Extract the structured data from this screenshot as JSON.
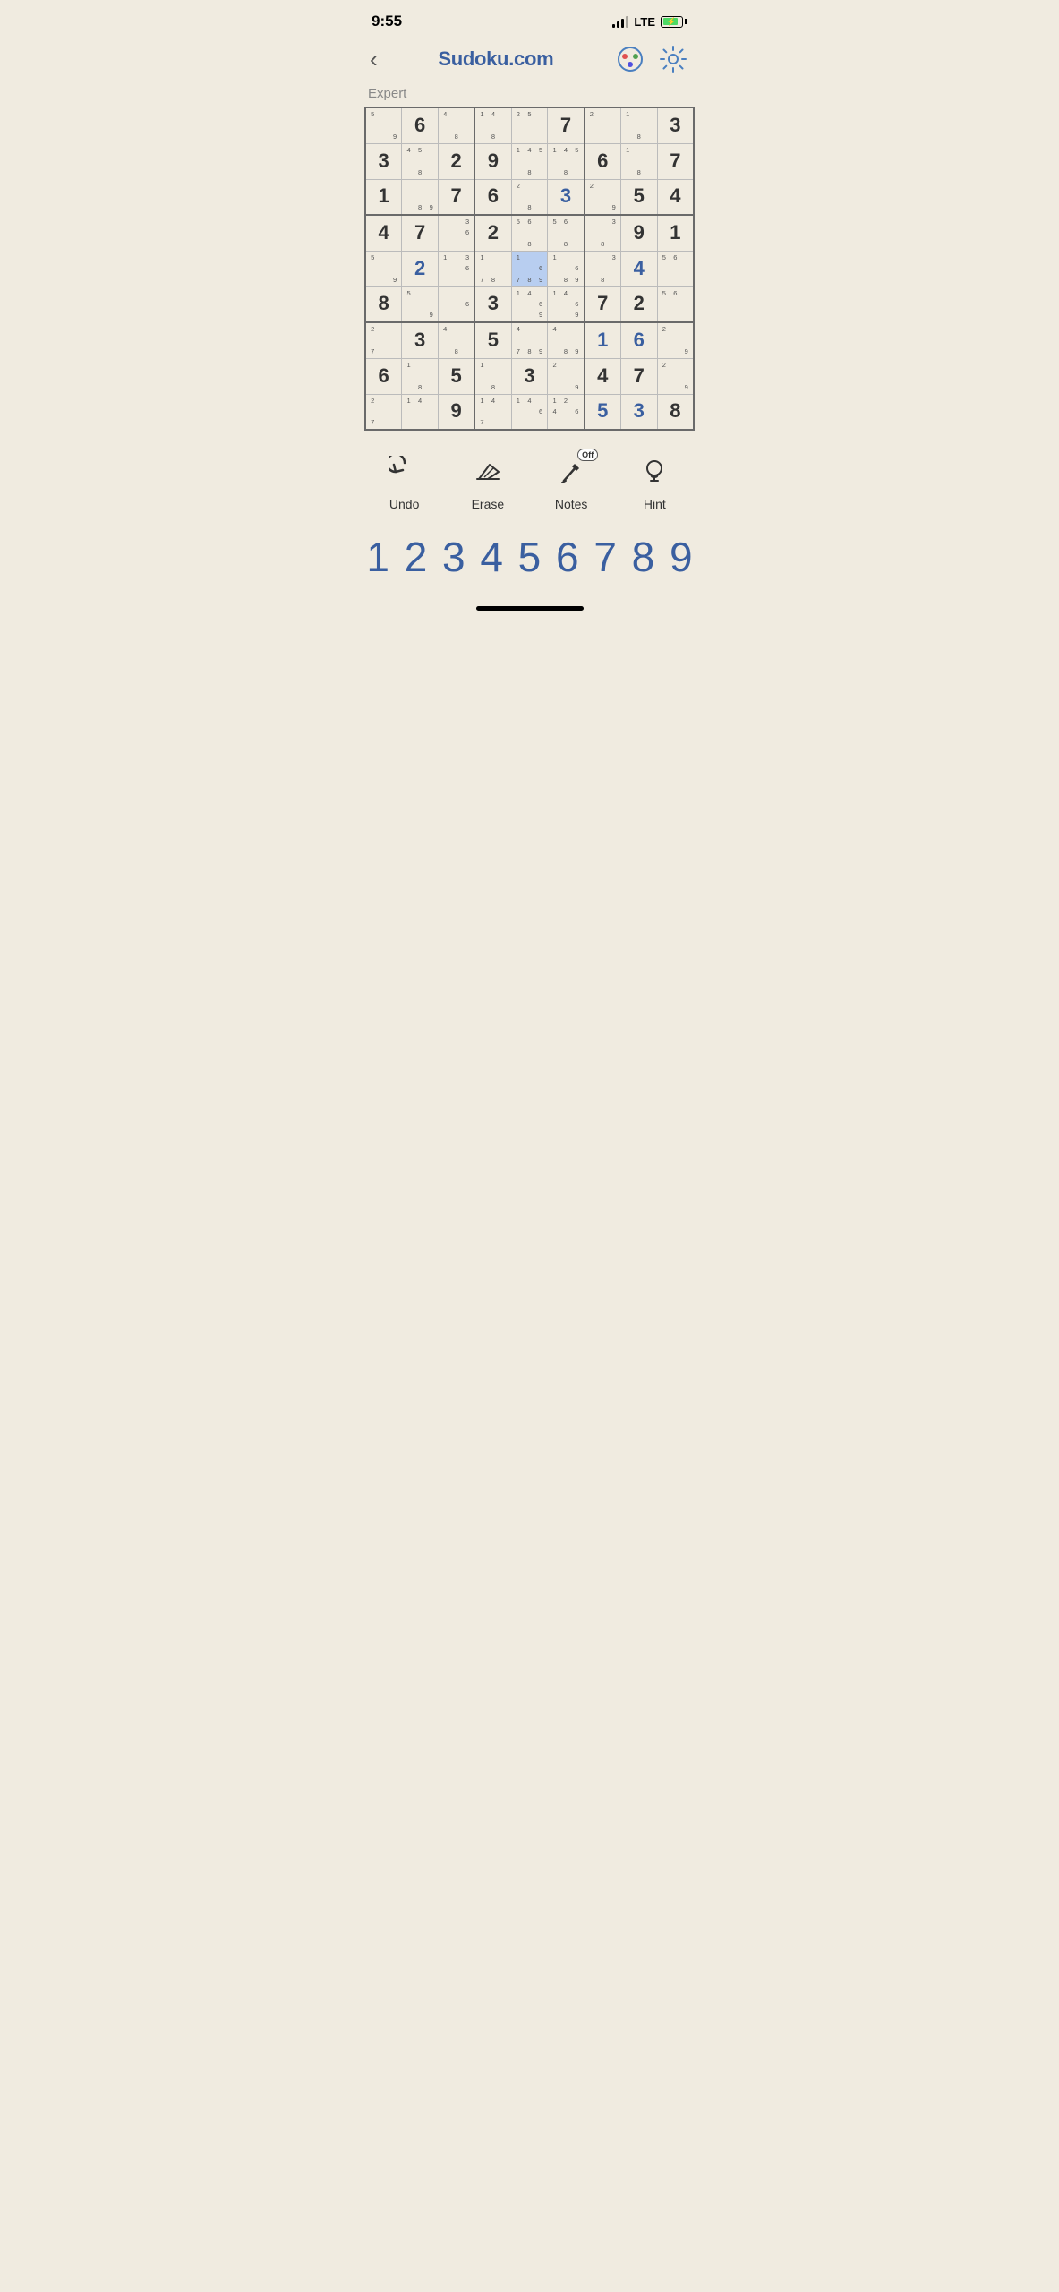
{
  "statusBar": {
    "time": "9:55",
    "lteLabel": "LTE"
  },
  "header": {
    "title": "Sudoku.com",
    "backLabel": "‹"
  },
  "difficulty": "Expert",
  "grid": {
    "cells": [
      [
        {
          "type": "notes",
          "notes": [
            "5",
            "",
            "",
            "",
            "",
            "",
            "",
            "",
            "9"
          ]
        },
        {
          "type": "given",
          "val": "6"
        },
        {
          "type": "notes",
          "notes": [
            "4",
            "",
            "",
            "",
            "",
            "",
            "",
            "8",
            ""
          ]
        },
        {
          "type": "notes",
          "notes": [
            "1",
            "4",
            "",
            "",
            "",
            "",
            "",
            "8",
            ""
          ]
        },
        {
          "type": "notes",
          "notes": [
            "2",
            "5",
            "",
            "",
            "",
            "",
            "",
            "",
            ""
          ]
        },
        {
          "type": "given",
          "val": "7"
        },
        {
          "type": "notes",
          "notes": [
            "2",
            "",
            "",
            "",
            "",
            "",
            "",
            "",
            ""
          ]
        },
        {
          "type": "notes",
          "notes": [
            "1",
            "",
            "",
            "",
            "",
            "",
            "",
            "8",
            ""
          ]
        },
        {
          "type": "given",
          "val": "3"
        }
      ],
      [
        {
          "type": "given",
          "val": "3"
        },
        {
          "type": "notes",
          "notes": [
            "4",
            "5",
            "",
            "",
            "",
            "",
            "",
            "8",
            ""
          ]
        },
        {
          "type": "given",
          "val": "2"
        },
        {
          "type": "given",
          "val": "9"
        },
        {
          "type": "notes",
          "notes": [
            "1",
            "4",
            "5",
            "",
            "",
            "",
            "",
            "8",
            ""
          ]
        },
        {
          "type": "notes",
          "notes": [
            "1",
            "4",
            "5",
            "",
            "",
            "",
            "",
            "8",
            ""
          ]
        },
        {
          "type": "given",
          "val": "6"
        },
        {
          "type": "notes",
          "notes": [
            "1",
            "",
            "",
            "",
            "",
            "",
            "",
            "8",
            ""
          ]
        },
        {
          "type": "given",
          "val": "7"
        }
      ],
      [
        {
          "type": "given",
          "val": "1"
        },
        {
          "type": "notes",
          "notes": [
            "",
            "",
            "",
            "",
            "",
            "",
            "",
            "8",
            "9"
          ]
        },
        {
          "type": "given",
          "val": "7"
        },
        {
          "type": "given",
          "val": "6"
        },
        {
          "type": "notes",
          "notes": [
            "2",
            "",
            "",
            "",
            "",
            "",
            "",
            "8",
            ""
          ]
        },
        {
          "type": "user",
          "val": "3"
        },
        {
          "type": "notes",
          "notes": [
            "2",
            "",
            "",
            "",
            "",
            "",
            "",
            "",
            ""
          ]
        },
        {
          "type": "given",
          "val": "5"
        },
        {
          "type": "given",
          "val": "4"
        }
      ],
      [
        {
          "type": "given",
          "val": "4"
        },
        {
          "type": "given",
          "val": "7"
        },
        {
          "type": "notes",
          "notes": [
            "",
            "",
            "3",
            "",
            "",
            "6",
            "",
            "",
            ""
          ]
        },
        {
          "type": "given",
          "val": "2"
        },
        {
          "type": "notes",
          "notes": [
            "5",
            "6",
            "",
            "",
            "",
            "",
            "",
            "8",
            ""
          ]
        },
        {
          "type": "notes",
          "notes": [
            "5",
            "6",
            "",
            "",
            "",
            "",
            "",
            "8",
            ""
          ]
        },
        {
          "type": "notes",
          "notes": [
            "",
            "",
            "3",
            "",
            "",
            "",
            "",
            "8",
            ""
          ]
        },
        {
          "type": "given",
          "val": "9"
        },
        {
          "type": "given",
          "val": "1"
        }
      ],
      [
        {
          "type": "notes",
          "notes": [
            "5",
            "",
            "",
            "",
            "",
            "",
            "",
            "",
            "9"
          ]
        },
        {
          "type": "user",
          "val": "2"
        },
        {
          "type": "notes",
          "notes": [
            "1",
            "",
            "3",
            "",
            "",
            "6",
            "",
            "",
            ""
          ]
        },
        {
          "type": "notes",
          "notes": [
            "1",
            "",
            "",
            "",
            "",
            "",
            "7",
            "8",
            ""
          ]
        },
        {
          "type": "highlighted",
          "notes": [
            "1",
            "",
            "",
            "",
            "",
            "6",
            "7",
            "8",
            "9"
          ]
        },
        {
          "type": "notes",
          "notes": [
            "1",
            "",
            "",
            "",
            "",
            "6",
            "",
            "8",
            "9"
          ]
        },
        {
          "type": "notes",
          "notes": [
            "",
            "",
            "3",
            "",
            "",
            "",
            "",
            "8",
            ""
          ]
        },
        {
          "type": "user",
          "val": "4"
        },
        {
          "type": "notes",
          "notes": [
            "5",
            "6",
            "",
            "",
            "",
            "",
            "",
            "",
            ""
          ]
        },
        {
          "type": "notes",
          "notes": [
            "5",
            "6",
            ""
          ]
        }
      ],
      [
        {
          "type": "given",
          "val": "8"
        },
        {
          "type": "notes",
          "notes": [
            "5",
            "",
            "",
            "",
            "",
            "",
            "",
            "",
            "9"
          ]
        },
        {
          "type": "notes",
          "notes": [
            "",
            "",
            "",
            "",
            "",
            "6",
            "",
            "",
            ""
          ]
        },
        {
          "type": "given",
          "val": "3"
        },
        {
          "type": "notes",
          "notes": [
            "1",
            "4",
            "",
            "",
            "",
            "6",
            "",
            "",
            "9"
          ]
        },
        {
          "type": "notes",
          "notes": [
            "1",
            "4",
            "",
            "",
            "",
            "6",
            "",
            "",
            "9"
          ]
        },
        {
          "type": "given",
          "val": "7"
        },
        {
          "type": "given",
          "val": "2"
        },
        {
          "type": "notes",
          "notes": [
            "5",
            "6",
            ""
          ]
        }
      ],
      [
        {
          "type": "notes",
          "notes": [
            "2",
            "",
            "",
            "",
            "",
            "",
            "7",
            "",
            ""
          ]
        },
        {
          "type": "given",
          "val": "3"
        },
        {
          "type": "notes",
          "notes": [
            "4",
            "",
            "",
            "",
            "",
            "",
            "",
            "8",
            ""
          ]
        },
        {
          "type": "given",
          "val": "5"
        },
        {
          "type": "notes",
          "notes": [
            "4",
            "",
            "",
            "",
            "",
            "",
            "7",
            "8",
            "9"
          ]
        },
        {
          "type": "notes",
          "notes": [
            "4",
            "",
            "",
            "",
            "",
            "",
            "",
            "8",
            "9"
          ]
        },
        {
          "type": "user",
          "val": "1"
        },
        {
          "type": "user",
          "val": "6"
        },
        {
          "type": "notes",
          "notes": [
            "2",
            "",
            "",
            "",
            "",
            "",
            "",
            "",
            "9"
          ]
        }
      ],
      [
        {
          "type": "given",
          "val": "6"
        },
        {
          "type": "notes",
          "notes": [
            "1",
            "",
            "",
            "",
            "",
            "",
            "",
            "8",
            ""
          ]
        },
        {
          "type": "given",
          "val": "5"
        },
        {
          "type": "notes",
          "notes": [
            "1",
            "",
            "",
            "",
            "",
            "",
            "",
            "8",
            ""
          ]
        },
        {
          "type": "given",
          "val": "3"
        },
        {
          "type": "notes",
          "notes": [
            "2",
            "",
            "",
            "",
            "",
            "",
            "",
            "",
            "9"
          ]
        },
        {
          "type": "given",
          "val": "4"
        },
        {
          "type": "given",
          "val": "7"
        },
        {
          "type": "notes",
          "notes": [
            "2",
            "",
            "",
            "",
            "",
            "",
            "",
            "",
            "9"
          ]
        }
      ],
      [
        {
          "type": "notes",
          "notes": [
            "2",
            "",
            "",
            "",
            "",
            "",
            "7",
            "",
            ""
          ]
        },
        {
          "type": "notes",
          "notes": [
            "1",
            "4",
            "",
            "",
            "",
            "",
            "",
            "",
            ""
          ]
        },
        {
          "type": "given",
          "val": "9"
        },
        {
          "type": "notes",
          "notes": [
            "1",
            "4",
            "",
            "",
            "",
            "",
            "7",
            "",
            ""
          ]
        },
        {
          "type": "notes",
          "notes": [
            "1",
            "4",
            "",
            "",
            "",
            "6",
            "",
            "",
            ""
          ]
        },
        {
          "type": "notes",
          "notes": [
            "1",
            "2",
            "",
            "4",
            "",
            "6",
            "",
            "",
            ""
          ]
        },
        {
          "type": "user",
          "val": "5"
        },
        {
          "type": "user",
          "val": "3"
        },
        {
          "type": "given",
          "val": "8"
        }
      ]
    ]
  },
  "toolbar": {
    "undo": "Undo",
    "erase": "Erase",
    "notes": "Notes",
    "notesStatus": "Off",
    "hint": "Hint"
  },
  "numpad": [
    "1",
    "2",
    "3",
    "4",
    "5",
    "6",
    "7",
    "8",
    "9"
  ]
}
